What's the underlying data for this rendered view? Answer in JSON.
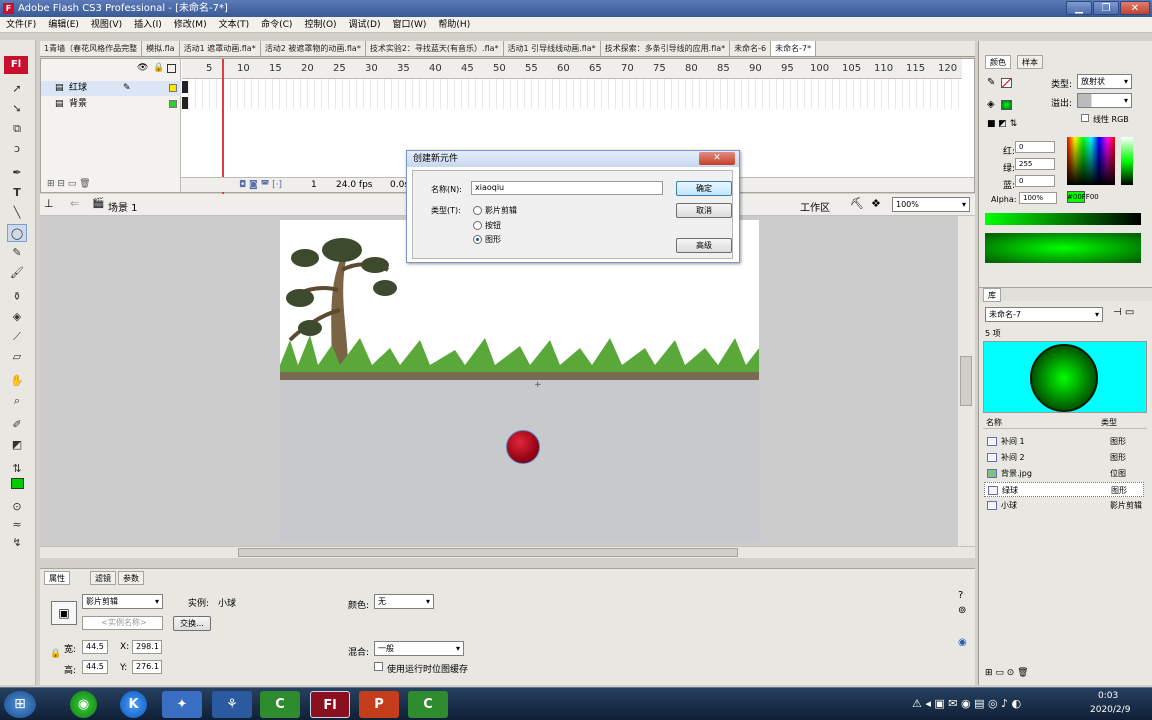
{
  "window": {
    "title": "Adobe Flash CS3 Professional - [未命名-7*]",
    "min": "▁",
    "max": "❐",
    "close": "✕"
  },
  "menu": [
    "文件(F)",
    "编辑(E)",
    "视图(V)",
    "插入(I)",
    "修改(M)",
    "文本(T)",
    "命令(C)",
    "控制(O)",
    "调试(D)",
    "窗口(W)",
    "帮助(H)"
  ],
  "doc_tabs": [
    "1青墙（春花风格作品完整",
    "模拟.fla",
    "活动1 遮罩动画.fla*",
    "活动2 被遮罩物的动画.fla*",
    "技术实验2：寻找蓝天(有音乐）.fla*",
    "活动1 引导线线动画.fla*",
    "技术探索：多条引导线的应用.fla*",
    "未命名-6",
    "未命名-7*"
  ],
  "timeline": {
    "ruler": [
      "5",
      "10",
      "15",
      "20",
      "25",
      "30",
      "35",
      "40",
      "45",
      "50",
      "55",
      "60",
      "65",
      "70",
      "75",
      "80",
      "85",
      "90",
      "95",
      "100",
      "105",
      "110",
      "115",
      "120"
    ],
    "layers": [
      {
        "name": "红球"
      },
      {
        "name": "背景"
      }
    ],
    "status": {
      "frame": "1",
      "fps": "24.0 fps",
      "time": "0.0s"
    }
  },
  "scene": {
    "label": "场景 1",
    "workspace": "工作区",
    "zoom": "100%"
  },
  "dialog": {
    "title": "创建新元件",
    "name_label": "名称(N):",
    "name_value": "xiaoqiu",
    "type_label": "类型(T):",
    "types": [
      {
        "label": "影片剪辑",
        "selected": false
      },
      {
        "label": "按钮",
        "selected": false
      },
      {
        "label": "图形",
        "selected": true
      }
    ],
    "ok": "确定",
    "cancel": "取消",
    "advanced": "高级",
    "close": "✕"
  },
  "props": {
    "tabs": [
      "属性",
      "滤镜",
      "参数"
    ],
    "symbol_type": "影片剪辑",
    "instance_label": "实例:",
    "instance_name": "小球",
    "instance_placeholder": "<实例名称>",
    "swap": "交换...",
    "width_label": "宽:",
    "width": "44.5",
    "height_label": "高:",
    "height": "44.5",
    "x_label": "X:",
    "x": "298.1",
    "y_label": "Y:",
    "y": "276.1",
    "color_label": "颜色:",
    "color_value": "无",
    "blend_label": "混合:",
    "blend_value": "一般",
    "cache_label": "使用运行时位图缓存"
  },
  "color_panel": {
    "tabs": [
      "颜色",
      "样本"
    ],
    "type_label": "类型:",
    "type_value": "放射状",
    "overflow_label": "溢出:",
    "linear_rgb": "线性 RGB",
    "r_label": "红:",
    "r": "0",
    "g_label": "绿:",
    "g": "255",
    "b_label": "蓝:",
    "b": "0",
    "alpha_label": "Alpha:",
    "alpha": "100%",
    "hex": "#00FF00"
  },
  "library": {
    "tab": "库",
    "doc": "未命名-7",
    "count": "5 项",
    "col_name": "名称",
    "col_type": "类型",
    "items": [
      {
        "name": "补间 1",
        "type": "图形"
      },
      {
        "name": "补间 2",
        "type": "图形"
      },
      {
        "name": "背景.jpg",
        "type": "位图"
      },
      {
        "name": "绿球",
        "type": "图形"
      },
      {
        "name": "小球",
        "type": "影片剪辑"
      }
    ]
  },
  "taskbar": {
    "time": "0:03",
    "date": "2020/2/9"
  },
  "colors": {
    "accent_green": "#00ff00",
    "preview_bg": "#00ffff",
    "ball_red": "#c8102e"
  }
}
